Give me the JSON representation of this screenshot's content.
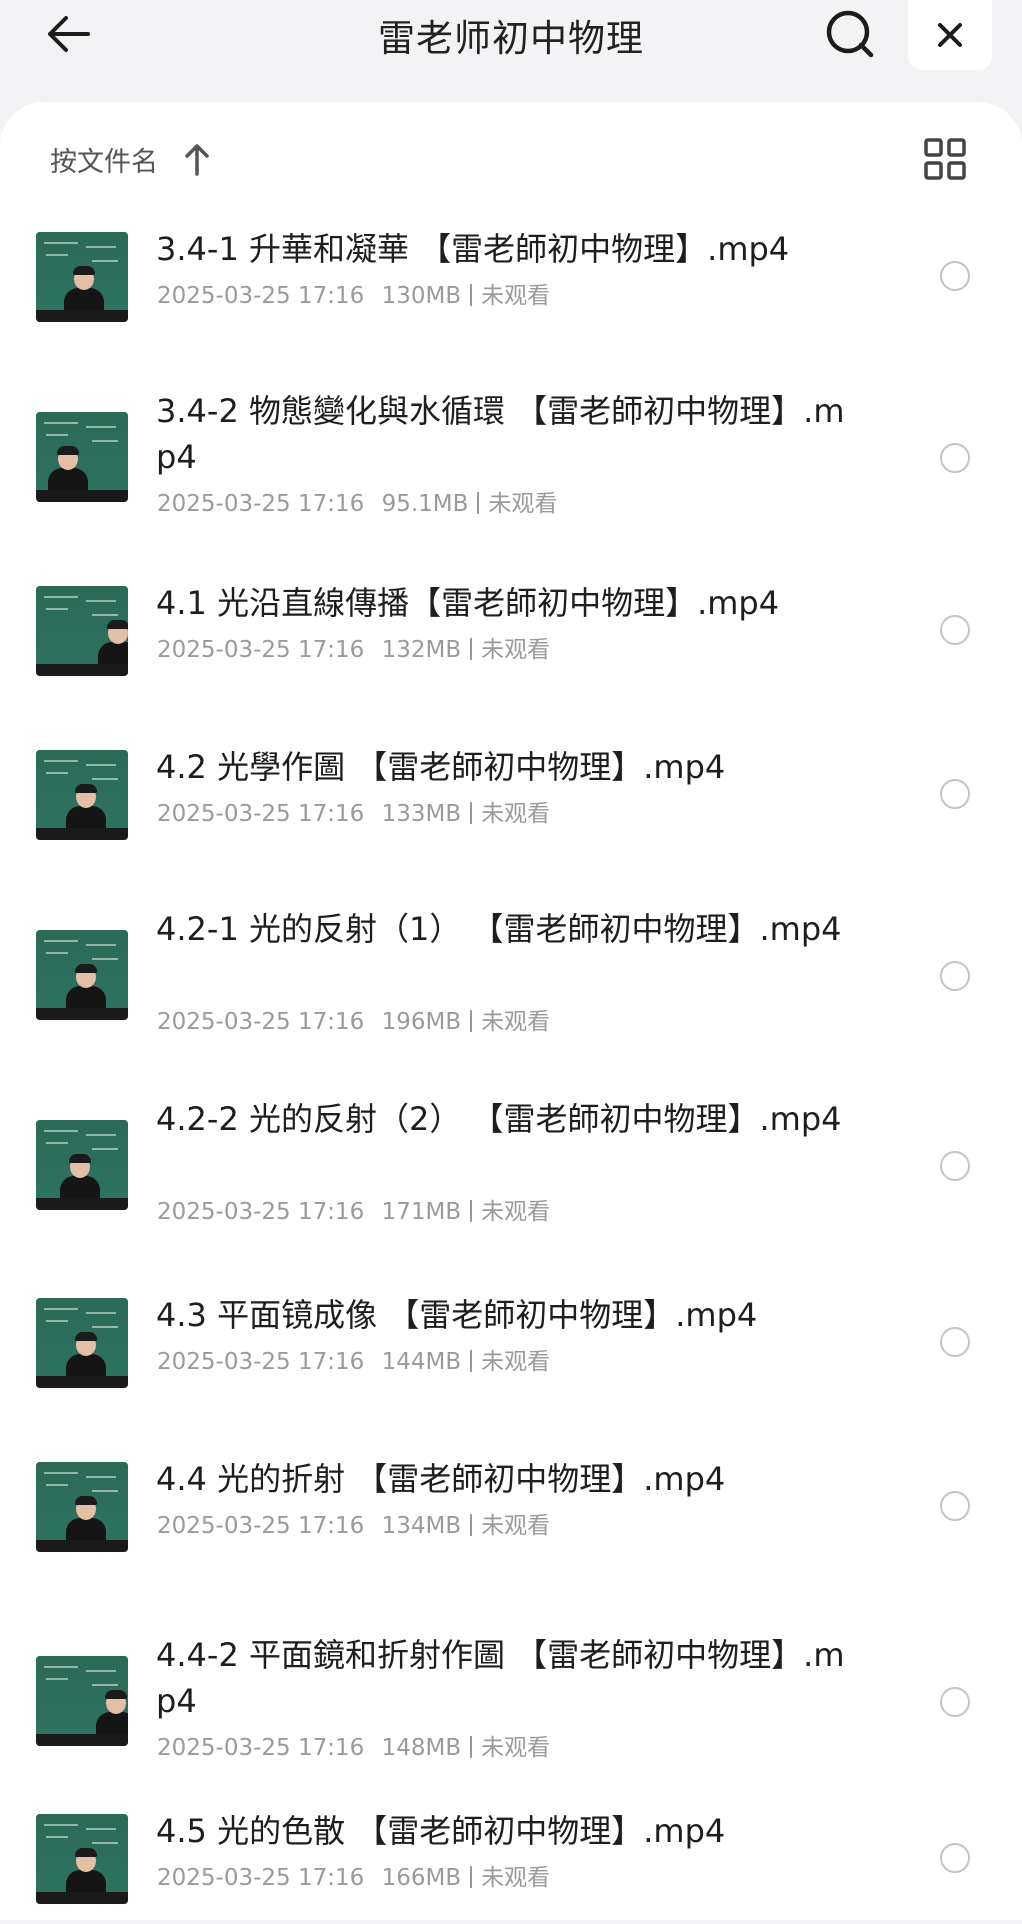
{
  "header": {
    "title": "雷老师初中物理",
    "back_icon": "arrow-left-icon",
    "search_icon": "search-icon",
    "close_icon": "close-icon"
  },
  "sort": {
    "label": "按文件名",
    "direction_icon": "arrow-up-icon",
    "view_toggle_icon": "grid-view-icon"
  },
  "files": [
    {
      "name": "3.4-1 升華和凝華 【雷老師初中物理】.mp4",
      "date": "2025-03-25 17:16",
      "size": "130MB",
      "status": "未观看"
    },
    {
      "name": "3.4-2 物態變化與水循環 【雷老師初中物理】.mp4",
      "date": "2025-03-25 17:16",
      "size": "95.1MB",
      "status": "未观看"
    },
    {
      "name": "4.1 光沿直線傳播【雷老師初中物理】.mp4",
      "date": "2025-03-25 17:16",
      "size": "132MB",
      "status": "未观看"
    },
    {
      "name": "4.2 光學作圖 【雷老師初中物理】.mp4",
      "date": "2025-03-25 17:16",
      "size": "133MB",
      "status": "未观看"
    },
    {
      "name": "4.2-1 光的反射（1） 【雷老師初中物理】.mp4",
      "date": "2025-03-25 17:16",
      "size": "196MB",
      "status": "未观看"
    },
    {
      "name": "4.2-2 光的反射（2） 【雷老師初中物理】.mp4",
      "date": "2025-03-25 17:16",
      "size": "171MB",
      "status": "未观看"
    },
    {
      "name": "4.3 平面镜成像 【雷老師初中物理】.mp4",
      "date": "2025-03-25 17:16",
      "size": "144MB",
      "status": "未观看"
    },
    {
      "name": "4.4 光的折射 【雷老師初中物理】.mp4",
      "date": "2025-03-25 17:16",
      "size": "134MB",
      "status": "未观看"
    },
    {
      "name": "4.4-2 平面鏡和折射作圖 【雷老師初中物理】.mp4",
      "date": "2025-03-25 17:16",
      "size": "148MB",
      "status": "未观看"
    },
    {
      "name": "4.5 光的色散 【雷老師初中物理】.mp4",
      "date": "2025-03-25 17:16",
      "size": "166MB",
      "status": "未观看"
    }
  ]
}
